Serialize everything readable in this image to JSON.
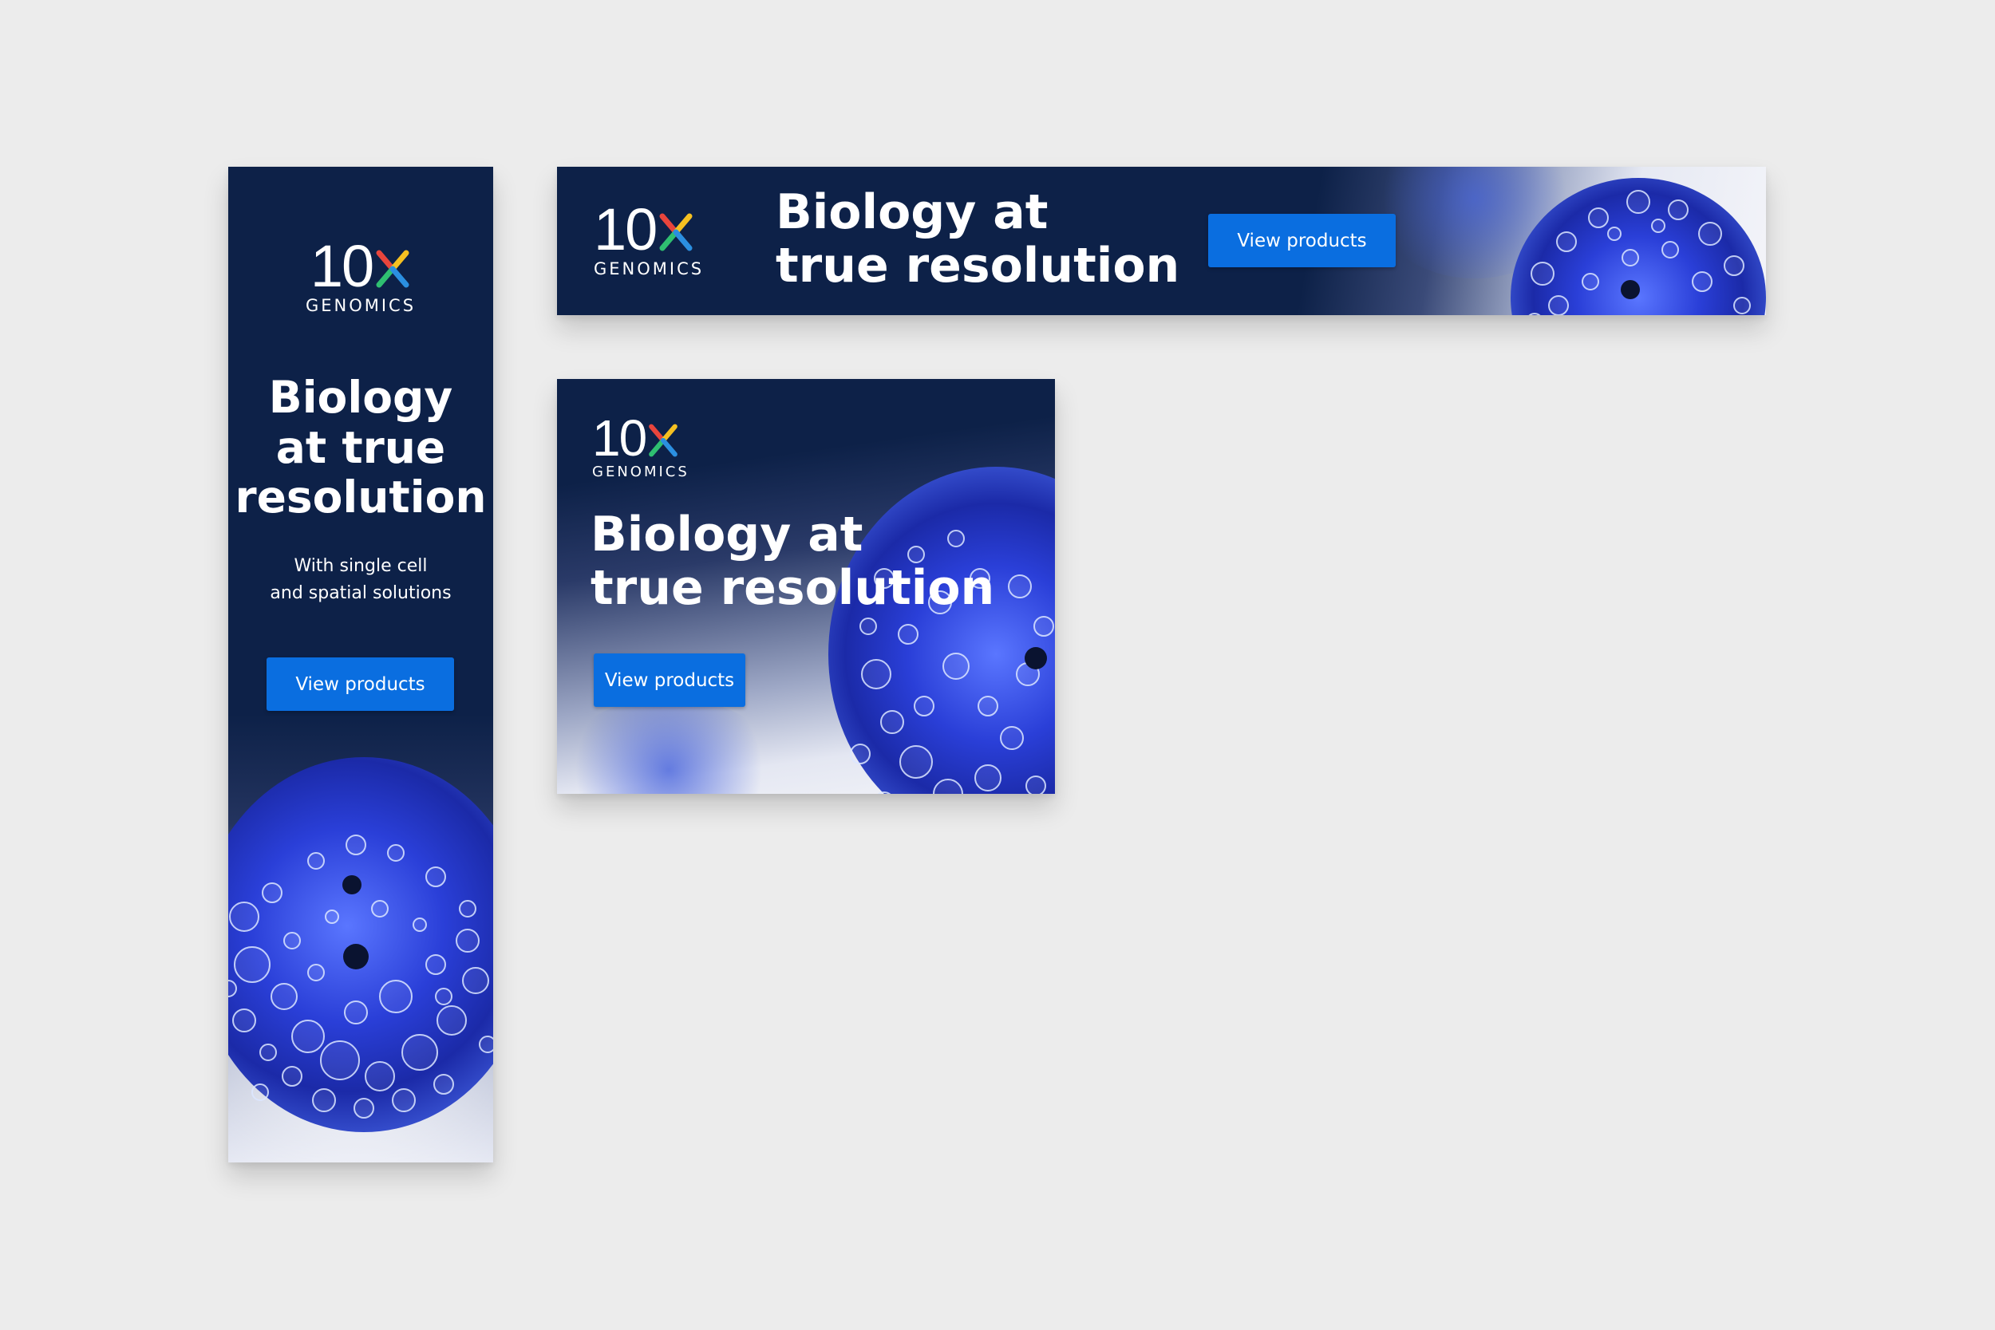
{
  "brand": {
    "logo_number": "10",
    "logo_x": "x",
    "logo_word": "GENOMICS",
    "colors": {
      "navy": "#0d2148",
      "cta": "#0a6ee0",
      "cell_blue": "#2a3fd8",
      "x_red": "#e8453c",
      "x_yellow": "#f5c021",
      "x_green": "#2fbf71",
      "x_blue": "#2b8fe0"
    }
  },
  "skyscraper": {
    "headline_lines": [
      "Biology",
      "at true",
      "resolution"
    ],
    "sub_lines": [
      "With single cell",
      "and spatial solutions"
    ],
    "cta_label": "View products"
  },
  "leaderboard": {
    "headline_lines": [
      "Biology at",
      "true resolution"
    ],
    "cta_label": "View products"
  },
  "rectangle": {
    "headline_lines": [
      "Biology at",
      "true resolution"
    ],
    "cta_label": "View products"
  }
}
